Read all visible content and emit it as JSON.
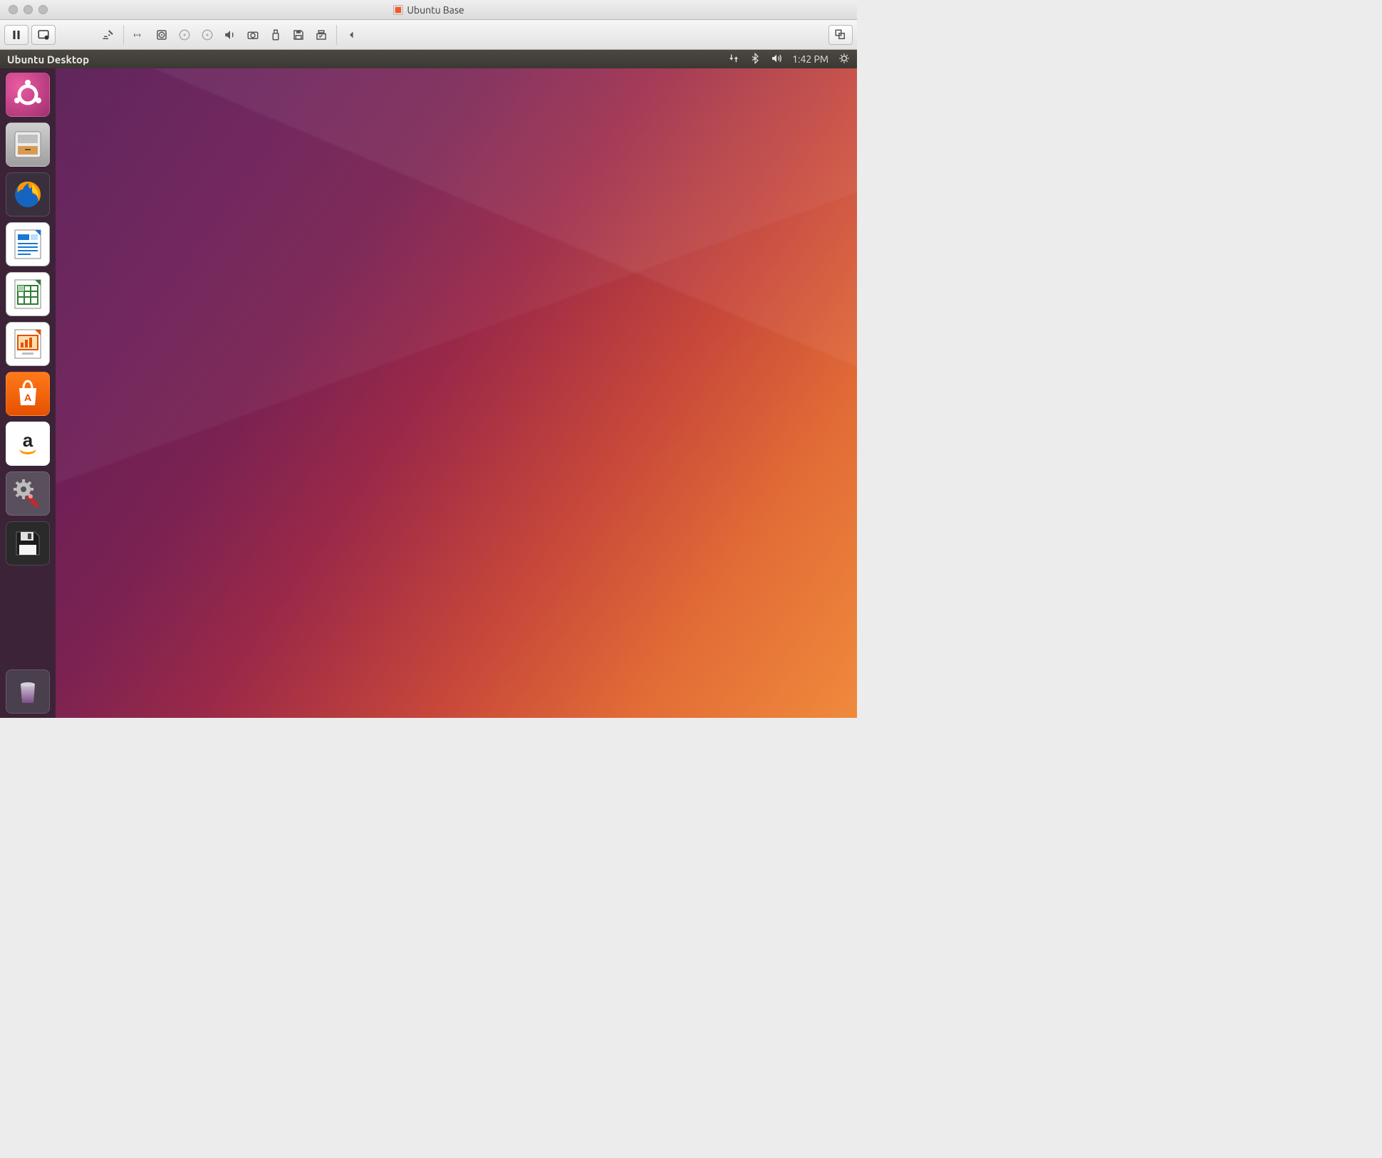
{
  "host_window": {
    "title": "Ubuntu Base"
  },
  "vm_toolbar": {
    "buttons_left": [
      "pause",
      "snapshot"
    ],
    "icons": [
      "settings",
      "network",
      "hard-disk",
      "optical-drive-1",
      "optical-drive-2",
      "audio",
      "camera",
      "usb",
      "floppy",
      "shared-folders",
      "collapse-arrow"
    ],
    "buttons_right": [
      "fullscreen"
    ]
  },
  "ubuntu_panel": {
    "title": "Ubuntu Desktop",
    "indicators": [
      "network-updown",
      "bluetooth",
      "volume"
    ],
    "time": "1:42 PM",
    "session_icon": "gear-power"
  },
  "launcher": {
    "items": [
      {
        "id": "dash-home",
        "name": "Dash / Search"
      },
      {
        "id": "files",
        "name": "Files"
      },
      {
        "id": "firefox",
        "name": "Firefox Web Browser"
      },
      {
        "id": "libreoffice-writer",
        "name": "LibreOffice Writer"
      },
      {
        "id": "libreoffice-calc",
        "name": "LibreOffice Calc"
      },
      {
        "id": "libreoffice-impress",
        "name": "LibreOffice Impress"
      },
      {
        "id": "ubuntu-software",
        "name": "Ubuntu Software"
      },
      {
        "id": "amazon",
        "name": "Amazon"
      },
      {
        "id": "system-settings",
        "name": "System Settings"
      },
      {
        "id": "disk-utility",
        "name": "Floppy / Save Media"
      }
    ],
    "trash": {
      "id": "trash",
      "name": "Trash"
    }
  }
}
